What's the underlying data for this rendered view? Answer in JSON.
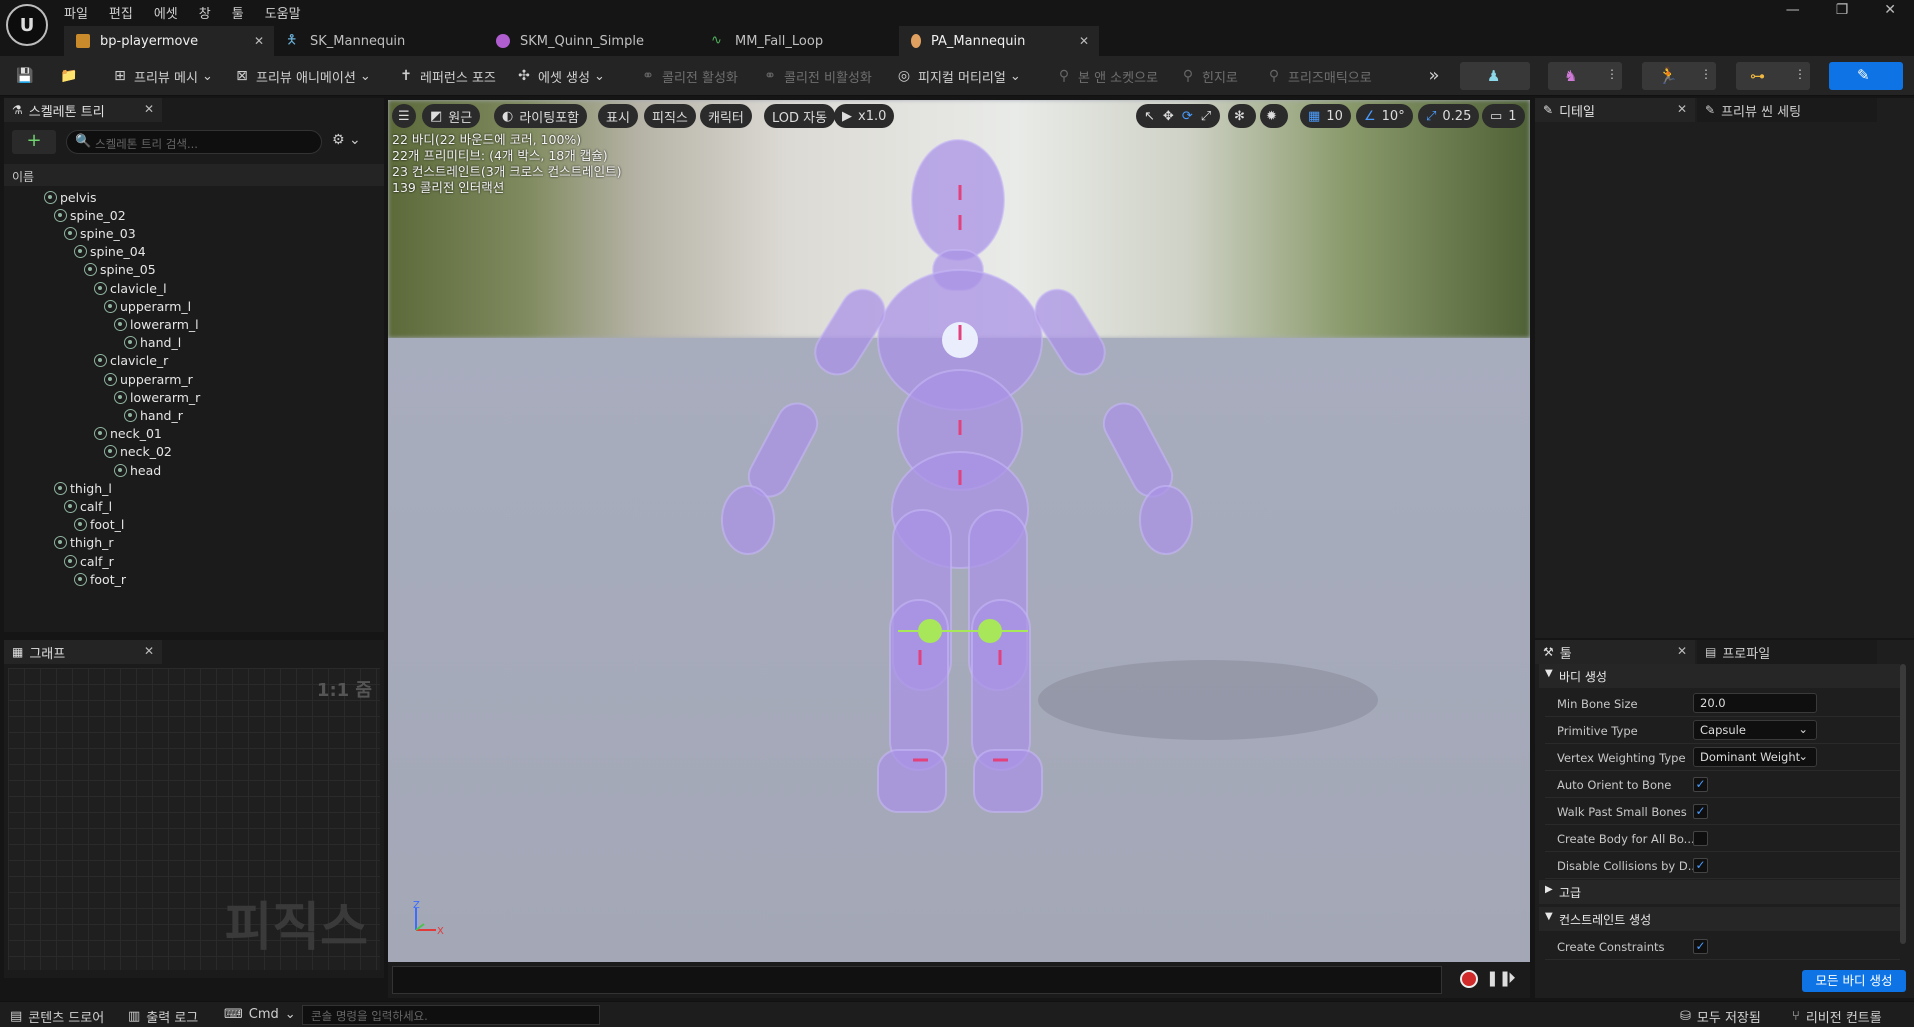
{
  "menu": [
    "파일",
    "편집",
    "에셋",
    "창",
    "툴",
    "도움말"
  ],
  "tabs": [
    {
      "label": "bp-playermove",
      "icon": "blueprint-icon",
      "active": true
    },
    {
      "label": "SK_Mannequin",
      "icon": "skeleton-icon",
      "active": false
    },
    {
      "label": "SKM_Quinn_Simple",
      "icon": "skeletal-mesh-icon",
      "active": false
    },
    {
      "label": "MM_Fall_Loop",
      "icon": "animation-icon",
      "active": false
    },
    {
      "label": "PA_Mannequin",
      "icon": "physics-asset-icon",
      "active": true
    }
  ],
  "toolbar": {
    "preview_mesh": "프리뷰 메시",
    "preview_anim": "프리뷰 애니메이션",
    "ref_pose": "레퍼런스 포즈",
    "create_asset": "에셋 생성",
    "enable_collision": "콜리전 활성화",
    "disable_collision": "콜리전 비활성화",
    "physical_material": "피지컬 머티리얼",
    "bone_to_socket": "본 앤 소켓으로",
    "constraint": "힌지로",
    "prismatic": "프리즈매틱으로"
  },
  "skeleton_tree": {
    "title": "스켈레톤 트리",
    "search_placeholder": "스켈레톤 트리 검색...",
    "column": "이름",
    "bones": [
      {
        "name": "pelvis",
        "depth": 0
      },
      {
        "name": "spine_02",
        "depth": 1
      },
      {
        "name": "spine_03",
        "depth": 2
      },
      {
        "name": "spine_04",
        "depth": 3
      },
      {
        "name": "spine_05",
        "depth": 4
      },
      {
        "name": "clavicle_l",
        "depth": 5
      },
      {
        "name": "upperarm_l",
        "depth": 6
      },
      {
        "name": "lowerarm_l",
        "depth": 7
      },
      {
        "name": "hand_l",
        "depth": 8
      },
      {
        "name": "clavicle_r",
        "depth": 5
      },
      {
        "name": "upperarm_r",
        "depth": 6
      },
      {
        "name": "lowerarm_r",
        "depth": 7
      },
      {
        "name": "hand_r",
        "depth": 8
      },
      {
        "name": "neck_01",
        "depth": 5
      },
      {
        "name": "neck_02",
        "depth": 6
      },
      {
        "name": "head",
        "depth": 7
      },
      {
        "name": "thigh_l",
        "depth": 1
      },
      {
        "name": "calf_l",
        "depth": 2
      },
      {
        "name": "foot_l",
        "depth": 3
      },
      {
        "name": "thigh_r",
        "depth": 1
      },
      {
        "name": "calf_r",
        "depth": 2
      },
      {
        "name": "foot_r",
        "depth": 3
      }
    ]
  },
  "graph": {
    "title": "그래프",
    "zoom": "1:1 줌",
    "watermark": "피직스"
  },
  "viewport": {
    "buttons": {
      "perspective": "원근",
      "lighting": "라이팅포함",
      "show": "표시",
      "physics": "피직스",
      "character": "캐릭터",
      "lod": "LOD 자동",
      "speed": "x1.0"
    },
    "right_values": {
      "grid": "10",
      "angle": "10°",
      "scale": "0.25",
      "camera": "1"
    },
    "stats": [
      "22 바디(22 바운드에 코러, 100%)",
      "22개 프리미티브: (4개 박스, 18개 캡슐)",
      "23 컨스트레인트(3개 크로스 컨스트레인트)",
      "139 콜리전 인터랙션"
    ]
  },
  "details": {
    "tab1": "디테일",
    "tab2": "프리뷰 씬 세팅"
  },
  "tools": {
    "tab1": "툴",
    "tab2": "프로파일",
    "section_body": "바디 생성",
    "props": [
      {
        "label": "Min Bone Size",
        "value": "20.0",
        "kind": "text"
      },
      {
        "label": "Primitive Type",
        "value": "Capsule",
        "kind": "select"
      },
      {
        "label": "Vertex Weighting Type",
        "value": "Dominant Weight",
        "kind": "select"
      },
      {
        "label": "Auto Orient to Bone",
        "value": "true",
        "kind": "check"
      },
      {
        "label": "Walk Past Small Bones",
        "value": "true",
        "kind": "check"
      },
      {
        "label": "Create Body for All Bo...",
        "value": "false",
        "kind": "check"
      },
      {
        "label": "Disable Collisions by D...",
        "value": "true",
        "kind": "check"
      }
    ],
    "section_advanced": "고급",
    "section_constraint": "컨스트레인트 생성",
    "create_constraints_label": "Create Constraints",
    "create_constraints_value": "true",
    "generate_button": "모든 바디 생성"
  },
  "statusbar": {
    "content_drawer": "콘텐츠 드로어",
    "output_log": "출력 로그",
    "cmd": "Cmd",
    "console_placeholder": "콘솔 명령을 입력하세요.",
    "save_all": "모두 저장됨",
    "revision": "리비전 컨트롤"
  },
  "colors": {
    "accent": "#0e74e6",
    "bg": "#151515",
    "panel": "#1b1b1b",
    "body_purple": "#a58fe0",
    "floor": "#a5a9b8"
  }
}
